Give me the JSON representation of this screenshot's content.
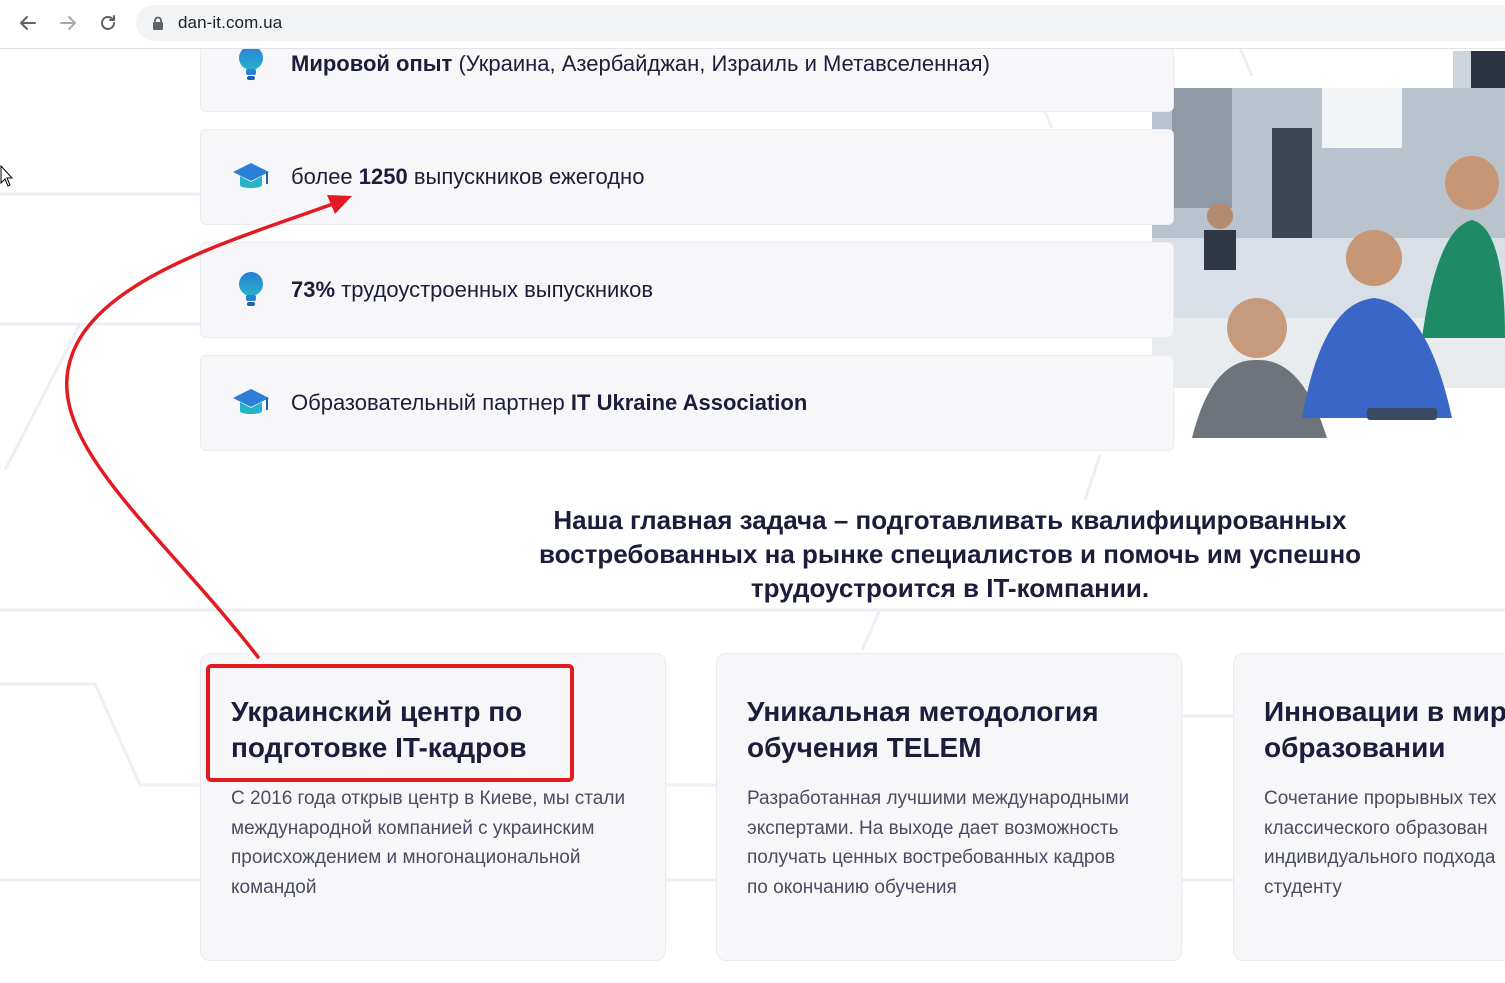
{
  "browser": {
    "url": "dan-it.com.ua"
  },
  "stats": [
    {
      "bold_prefix": "Мировой опыт",
      "text": " (Украина, Азербайджан, Израиль и Метавселенная)",
      "bold_suffix": "",
      "icon": "lightbulb-icon"
    },
    {
      "prefix": "более ",
      "bold": "1250",
      "text": " выпускников ежегодно",
      "icon": "graduation-cap-icon"
    },
    {
      "bold_prefix": "73%",
      "text": " трудоустроенных выпускников",
      "icon": "lightbulb-icon"
    },
    {
      "text": "Образовательный партнер ",
      "bold": "IT Ukraine Association",
      "icon": "graduation-cap-icon"
    }
  ],
  "mission": {
    "line1": "Наша главная задача – подготавливать квалифицированных",
    "line2": "востребованных на рынке специалистов и помочь им успешно",
    "line3": "трудоустроится в IT-компании."
  },
  "cards": [
    {
      "title_line1": "Украинский центр по",
      "title_line2": "подготовке IT-кадров",
      "body": [
        "С 2016 года открыв центр в Киеве, мы стали",
        "международной компанией с украинским",
        "происхождением и многонациональной",
        "командой"
      ]
    },
    {
      "title_line1": "Уникальная методология",
      "title_line2": "обучения TELEM",
      "body": [
        "Разработанная лучшими международными",
        "экспертами. На выходе дает возможность",
        "получать ценных востребованных кадров",
        "по окончанию обучения"
      ]
    },
    {
      "title_line1": "Инновации в миро",
      "title_line2": "образовании",
      "body": [
        "Сочетание прорывных тех",
        "классического образован",
        "индивидуального подхода",
        "студенту"
      ]
    }
  ],
  "colors": {
    "annotation": "#e21b23",
    "icon_blue": "#2c7fd6",
    "icon_teal": "#24b3c9",
    "text_dark": "#1c1d3a"
  }
}
